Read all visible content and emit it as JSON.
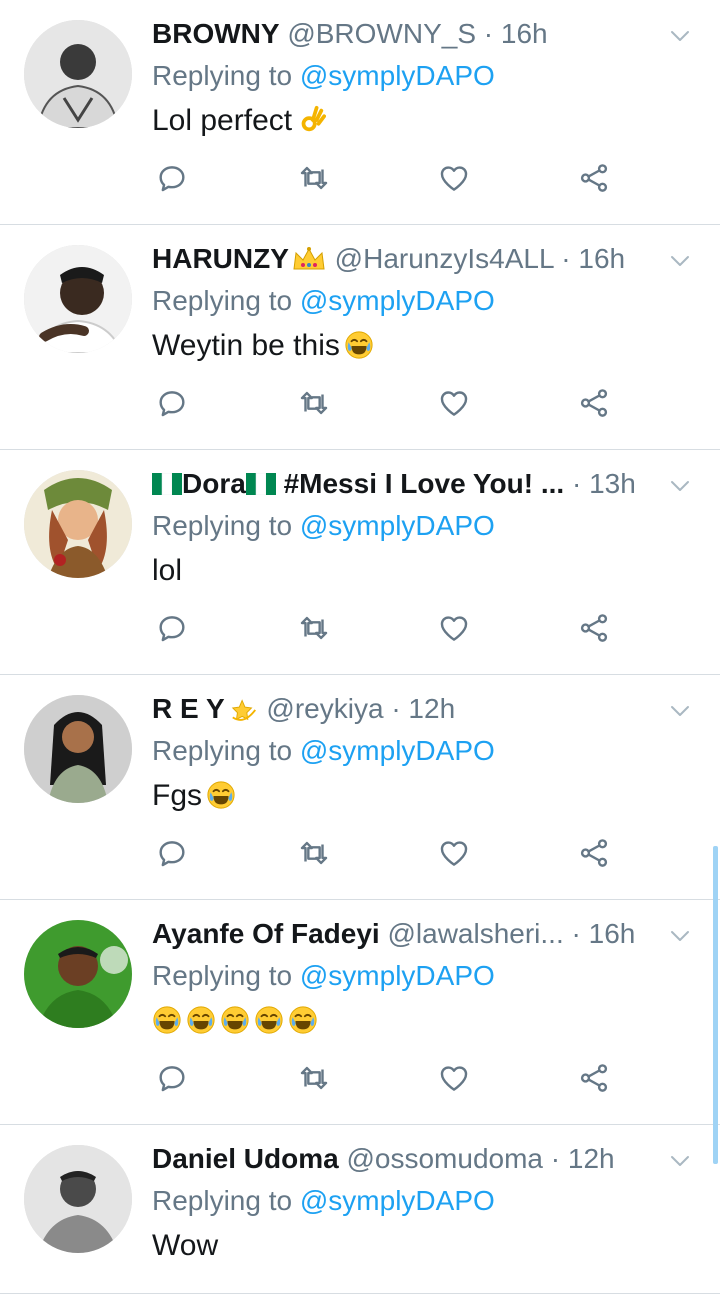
{
  "colors": {
    "accent": "#1da1f2",
    "secondary_text": "#657786",
    "divider": "#d7dde2"
  },
  "icons": {
    "reply": "reply-icon",
    "retweet": "retweet-icon",
    "like": "heart-icon",
    "share": "share-icon",
    "menu": "chevron-down-icon"
  },
  "tweets": [
    {
      "name": "BROWNY",
      "handle": "@BROWNY_S",
      "separator": "·",
      "time": "16h",
      "replying_label": "Replying to",
      "mention": "@symplyDAPO",
      "text": "Lol perfect"
    },
    {
      "name": "HARUNZY",
      "handle": "@HarunzyIs4ALL",
      "separator": "·",
      "time": "16h",
      "replying_label": "Replying to",
      "mention": "@symplyDAPO",
      "text": "Weytin be this"
    },
    {
      "name": "Dora",
      "name_suffix": "#Messi I Love You! ...",
      "separator": "·",
      "time": "13h",
      "replying_label": "Replying to",
      "mention": "@symplyDAPO",
      "text": "lol"
    },
    {
      "name": "R E Y",
      "handle": "@reykiya",
      "separator": "·",
      "time": "12h",
      "replying_label": "Replying to",
      "mention": "@symplyDAPO",
      "text": "Fgs"
    },
    {
      "name": "Ayanfe Of Fadeyi",
      "handle": "@lawalsheri...",
      "separator": "·",
      "time": "16h",
      "replying_label": "Replying to",
      "mention": "@symplyDAPO",
      "text": ""
    },
    {
      "name": "Daniel Udoma",
      "handle": "@ossomudoma",
      "separator": "·",
      "time": "12h",
      "replying_label": "Replying to",
      "mention": "@symplyDAPO",
      "text": "Wow"
    }
  ]
}
